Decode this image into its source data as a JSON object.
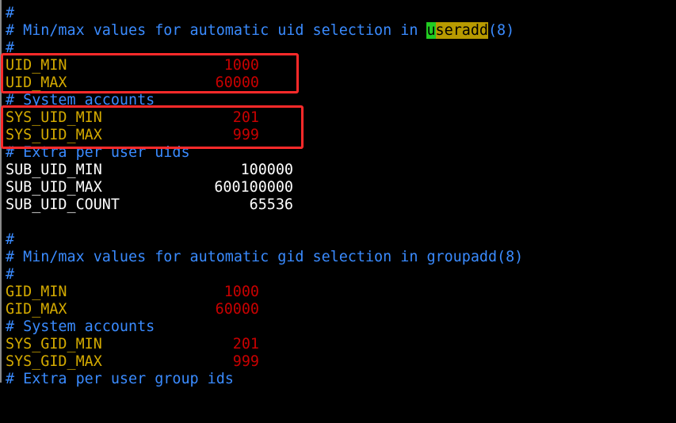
{
  "colors": {
    "background": "#000000",
    "comment": "#3a8bff",
    "key": "#d4aa00",
    "value": "#c80000",
    "plain": "#ffffff",
    "search_highlight": "#22cc22",
    "annotation_frame": "#ff2a2a"
  },
  "lines": [
    {
      "kind": "comment",
      "text": "#"
    },
    {
      "kind": "comment",
      "pre": "# Min/max values for automatic uid selection in ",
      "hl_first": "u",
      "hl_rest": "seradd",
      "post": "(8)"
    },
    {
      "kind": "comment",
      "text": "#"
    },
    {
      "kind": "key",
      "key": "UID_MIN",
      "value": "1000"
    },
    {
      "kind": "key",
      "key": "UID_MAX",
      "value": "60000"
    },
    {
      "kind": "comment",
      "text": "# System accounts"
    },
    {
      "kind": "key",
      "key": "SYS_UID_MIN",
      "value": "201"
    },
    {
      "kind": "key",
      "key": "SYS_UID_MAX",
      "value": "999"
    },
    {
      "kind": "comment",
      "text": "# Extra per user uids"
    },
    {
      "kind": "plain",
      "key": "SUB_UID_MIN",
      "value": "100000"
    },
    {
      "kind": "plain",
      "key": "SUB_UID_MAX",
      "value": "600100000"
    },
    {
      "kind": "plain",
      "key": "SUB_UID_COUNT",
      "value": "65536"
    },
    {
      "kind": "blank",
      "text": ""
    },
    {
      "kind": "comment",
      "text": "#"
    },
    {
      "kind": "comment",
      "text": "# Min/max values for automatic gid selection in groupadd(8)"
    },
    {
      "kind": "comment",
      "text": "#"
    },
    {
      "kind": "key",
      "key": "GID_MIN",
      "value": "1000"
    },
    {
      "kind": "key",
      "key": "GID_MAX",
      "value": "60000"
    },
    {
      "kind": "comment",
      "text": "# System accounts"
    },
    {
      "kind": "key",
      "key": "SYS_GID_MIN",
      "value": "201"
    },
    {
      "kind": "key",
      "key": "SYS_GID_MAX",
      "value": "999"
    },
    {
      "kind": "comment",
      "text": "# Extra per user group ids"
    }
  ]
}
